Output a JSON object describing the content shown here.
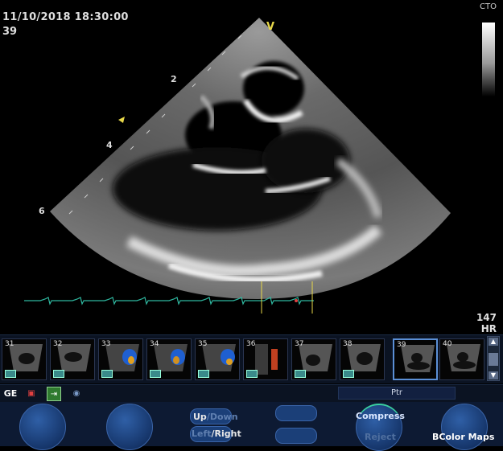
{
  "header": {
    "datetime": "11/10/2018 18:30:00",
    "frame_number": "39",
    "gray_map_label": "CTO",
    "orientation_marker": "V"
  },
  "depth_scale": [
    "2",
    "4",
    "6"
  ],
  "heart_rate": {
    "value": "147",
    "label": "HR"
  },
  "thumbnails": [
    {
      "num": "31",
      "type": "bw"
    },
    {
      "num": "32",
      "type": "bw"
    },
    {
      "num": "33",
      "type": "color"
    },
    {
      "num": "34",
      "type": "color"
    },
    {
      "num": "35",
      "type": "color"
    },
    {
      "num": "36",
      "type": "color-red"
    },
    {
      "num": "37",
      "type": "bw"
    },
    {
      "num": "38",
      "type": "bw"
    },
    {
      "num": "39",
      "type": "bw",
      "selected": true
    },
    {
      "num": "40",
      "type": "bw"
    }
  ],
  "toolbar": {
    "icons": [
      "ge-logo-icon",
      "printer-icon",
      "export-icon",
      "record-icon"
    ],
    "ptr_label": "Ptr"
  },
  "controls": {
    "up_label": "Up",
    "down_label": "Down",
    "left_label": "Left",
    "right_label": "Right",
    "compress_label": "Compress",
    "reject_label": "Reject",
    "bcolor_maps_label": "BColor Maps"
  },
  "colors": {
    "accent": "#5b8fd6",
    "ecg_trace": "#2fb8a0",
    "marker_yellow": "#e8d84a",
    "panel_bg": "#0d1a33"
  }
}
